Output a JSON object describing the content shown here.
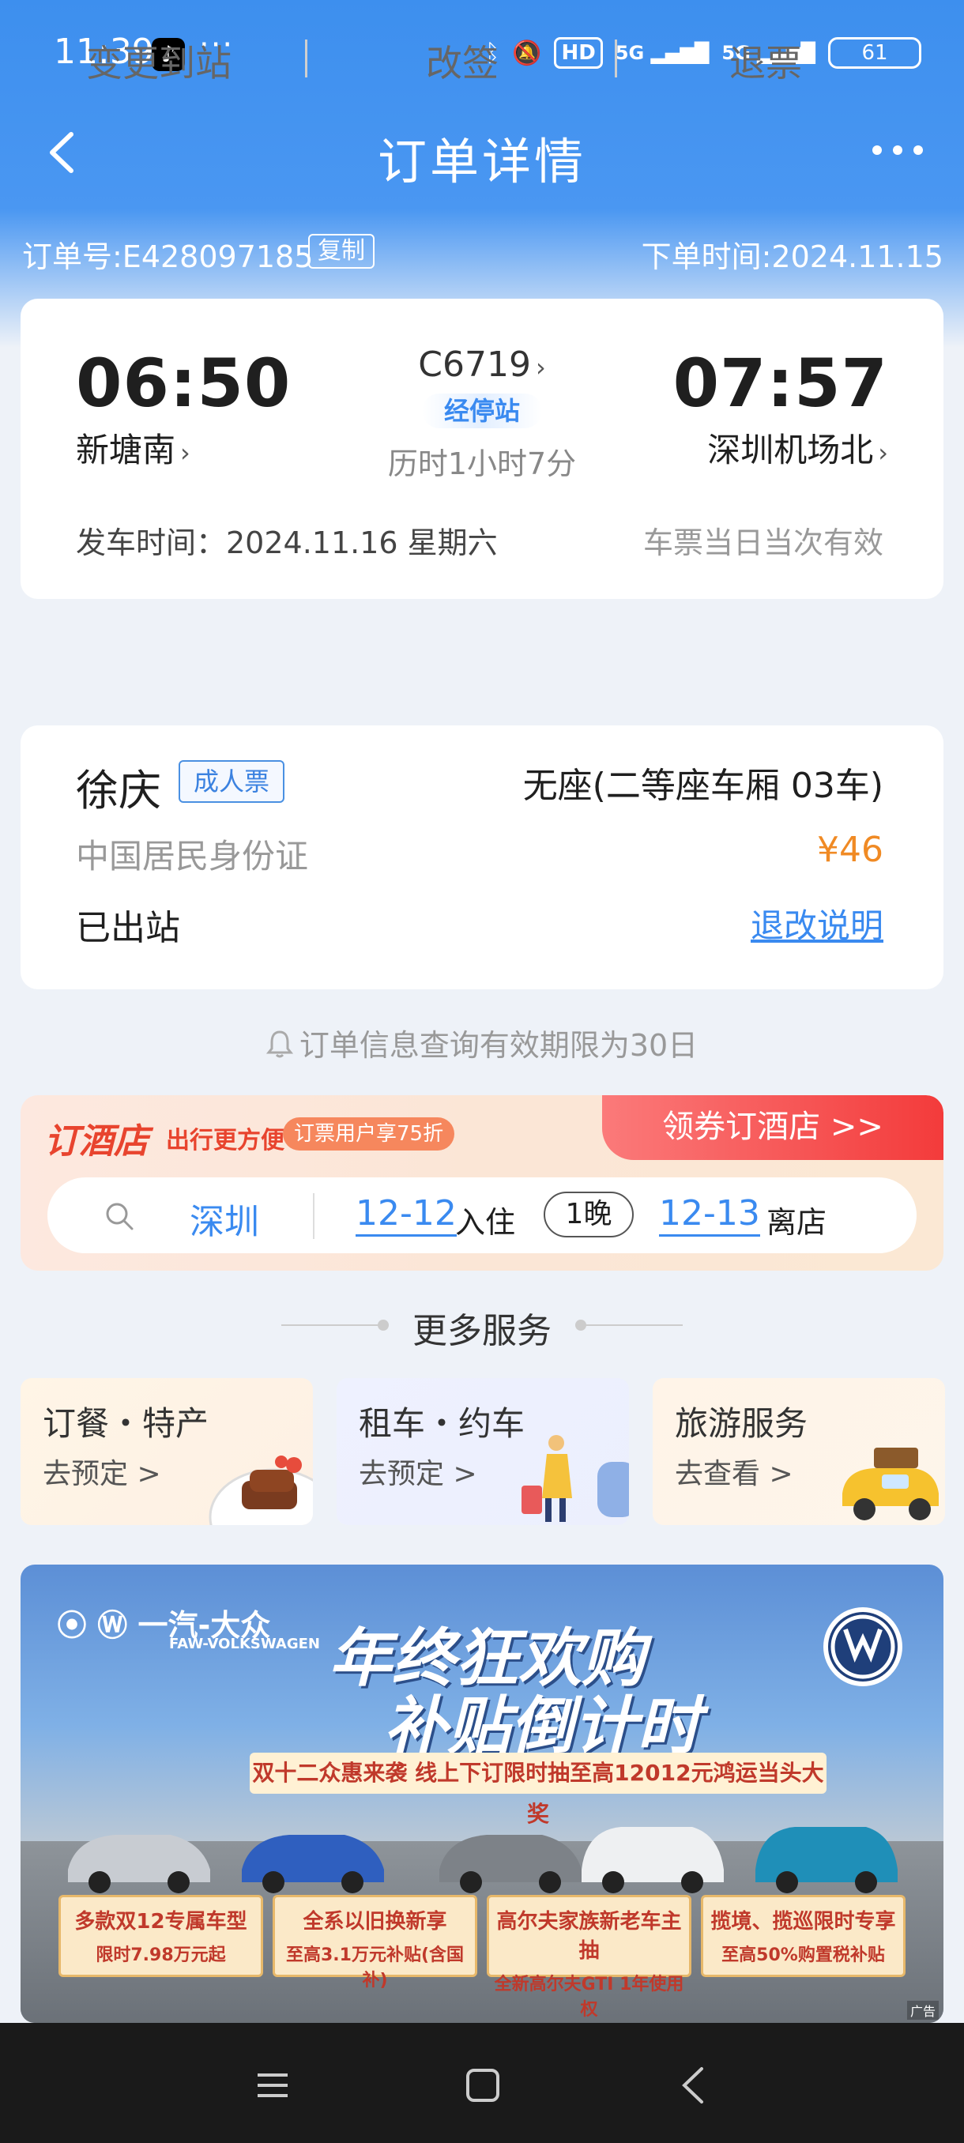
{
  "status_bar": {
    "time": "11:39",
    "dots": "···",
    "hd": "HD",
    "sig1": "5G",
    "sig2": "5G",
    "battery": "61"
  },
  "header": {
    "title": "订单详情"
  },
  "order": {
    "number": "订单号:E428097185",
    "copy": "复制",
    "time": "下单时间:2024.11.15"
  },
  "trip": {
    "dep_time": "06:50",
    "dep_station": "新塘南",
    "arr_time": "07:57",
    "arr_station": "深圳机场北",
    "train_no": "C6719",
    "stops": "经停站",
    "duration": "历时1小时7分",
    "date_line": "发车时间：2024.11.16 星期六",
    "valid_note": "车票当日当次有效"
  },
  "actions": {
    "change_station": "变更到站",
    "reschedule": "改签",
    "refund": "退票"
  },
  "passenger": {
    "name": "徐庆",
    "ticket_type": "成人票",
    "seat": "无座(二等座车厢 03车)",
    "id_type": "中国居民身份证",
    "price": "¥46",
    "status": "已出站",
    "rules": "退改说明"
  },
  "notice": "订单信息查询有效期限为30日",
  "hotel": {
    "brand": "订酒店",
    "slogan": "出行更方便",
    "discount": "订票用户享75折",
    "cta": "领券订酒店 >>",
    "city": "深圳",
    "checkin_date": "12-12",
    "checkin_label": "入住",
    "nights": "1晚",
    "checkout_date": "12-13",
    "checkout_label": "离店"
  },
  "more_services": {
    "title": "更多服务",
    "items": [
      {
        "title": "订餐・特产",
        "sub": "去预定 >"
      },
      {
        "title": "租车・约车",
        "sub": "去预定 >"
      },
      {
        "title": "旅游服务",
        "sub": "去查看 >"
      }
    ]
  },
  "ad": {
    "logo": "一汽-大众",
    "logo_sub": "FAW-VOLKSWAGEN",
    "headline1": "年终狂欢购",
    "headline2": "补贴倒计时",
    "strip": "双十二众惠来袭 线上下订限时抽至高12012元鸿运当头大奖",
    "boxes": [
      {
        "title": "多款双12专属车型",
        "sub": "限时7.98万元起"
      },
      {
        "title": "全系以旧换新享",
        "sub": "至高3.1万元补贴(含国补)"
      },
      {
        "title": "高尔夫家族新老车主抽",
        "sub": "全新高尔夫GTI 1年使用权"
      },
      {
        "title": "揽境、揽巡限时专享",
        "sub": "至高50%购置税补贴"
      }
    ],
    "tag": "广告"
  },
  "colors": {
    "primary_blue": "#3d8fee",
    "price_orange": "#f08a24",
    "hotel_red": "#e8442e"
  }
}
